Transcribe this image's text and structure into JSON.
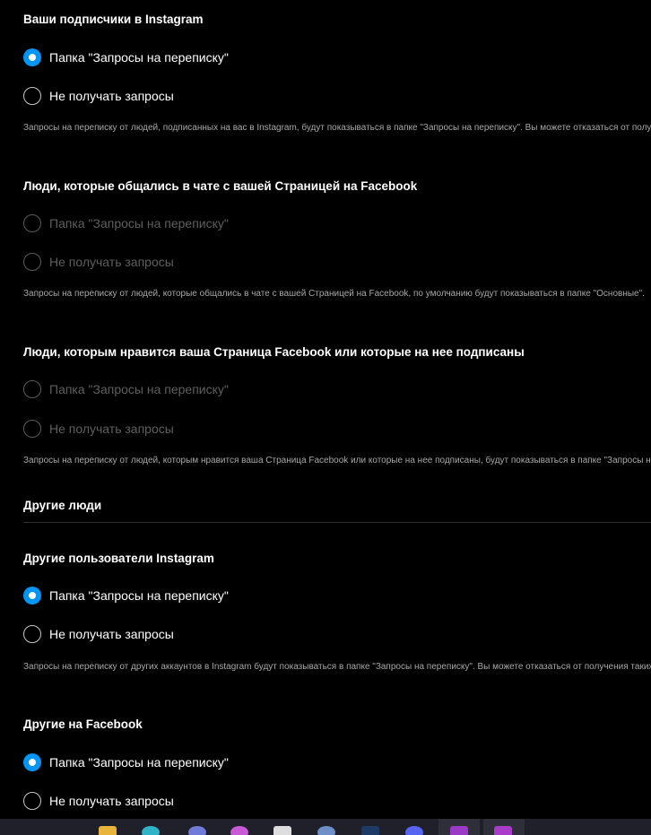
{
  "sections": [
    {
      "title": "Ваши подписчики в Instagram",
      "options": [
        {
          "label": "Папка \"Запросы на переписку\"",
          "checked": true,
          "disabled": false
        },
        {
          "label": "Не получать запросы",
          "checked": false,
          "disabled": false
        }
      ],
      "description": "Запросы на переписку от людей, подписанных на вас в Instagram, будут показываться в папке \"Запросы на переписку\". Вы можете отказаться от получения таких запросов."
    },
    {
      "title": "Люди, которые общались в чате с вашей Страницей на Facebook",
      "options": [
        {
          "label": "Папка \"Запросы на переписку\"",
          "checked": false,
          "disabled": true
        },
        {
          "label": "Не получать запросы",
          "checked": false,
          "disabled": true
        }
      ],
      "description": "Запросы на переписку от людей, которые общались в чате с вашей Страницей на Facebook, по умолчанию будут показываться в папке \"Основные\"."
    },
    {
      "title": "Люди, которым нравится ваша Страница Facebook или которые на нее подписаны",
      "options": [
        {
          "label": "Папка \"Запросы на переписку\"",
          "checked": false,
          "disabled": true
        },
        {
          "label": "Не получать запросы",
          "checked": false,
          "disabled": true
        }
      ],
      "description": "Запросы на переписку от людей, которым нравится ваша Страница Facebook или которые на нее подписаны, будут показываться в папке \"Запросы на переписку\"."
    }
  ],
  "other_people_heading": "Другие люди",
  "other_sections": [
    {
      "title": "Другие пользователи Instagram",
      "options": [
        {
          "label": "Папка \"Запросы на переписку\"",
          "checked": true,
          "disabled": false
        },
        {
          "label": "Не получать запросы",
          "checked": false,
          "disabled": false
        }
      ],
      "description": "Запросы на переписку от других аккаунтов в Instagram будут показываться в папке \"Запросы на переписку\". Вы можете отказаться от получения таких запросов."
    },
    {
      "title": "Другие на Facebook",
      "options": [
        {
          "label": "Папка \"Запросы на переписку\"",
          "checked": true,
          "disabled": false
        },
        {
          "label": "Не получать запросы",
          "checked": false,
          "disabled": false
        }
      ]
    }
  ],
  "taskbar": {
    "icons": [
      {
        "name": "file-explorer-icon",
        "color": "#e8b43a"
      },
      {
        "name": "edge-browser-icon",
        "color": "#2fb3c9"
      },
      {
        "name": "app-icon",
        "color": "#6f7ad9"
      },
      {
        "name": "app-icon",
        "color": "#c85ad8"
      },
      {
        "name": "app-icon",
        "color": "#dddddd"
      },
      {
        "name": "app-icon",
        "color": "#6e8fc8"
      },
      {
        "name": "photoshop-icon",
        "color": "#1d3a66"
      },
      {
        "name": "discord-icon",
        "color": "#5865f2"
      },
      {
        "name": "app-icon",
        "color": "#9c3ac8"
      },
      {
        "name": "app-icon",
        "color": "#a93cc8"
      }
    ]
  }
}
